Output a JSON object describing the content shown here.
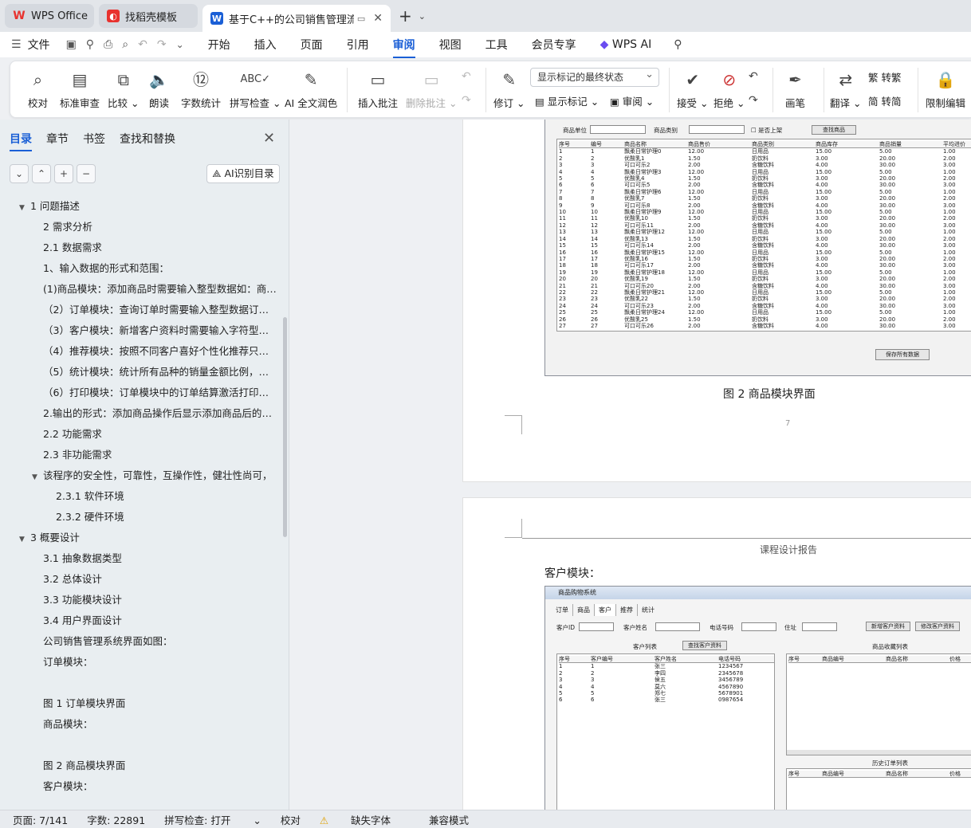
{
  "tabs": [
    {
      "label": "WPS Office",
      "icon": "wps-logo-icon",
      "color": "#e8322e"
    },
    {
      "label": "找稻壳模板",
      "icon": "docer-icon",
      "color": "#e8322e"
    },
    {
      "label": "基于C++的公司销售管理流程",
      "icon": "writer-icon",
      "color": "#1a5fd6"
    }
  ],
  "menu": {
    "file": "文件",
    "items": [
      "开始",
      "插入",
      "页面",
      "引用",
      "审阅",
      "视图",
      "工具",
      "会员专享"
    ],
    "active": "审阅",
    "wps_ai": "WPS AI"
  },
  "toolbar": {
    "proofread": "校对",
    "std_review": "标准审查",
    "compare": "比较",
    "read_aloud": "朗读",
    "word_count": "字数统计",
    "spell_check": "拼写检查",
    "ai_polish": "AI 全文润色",
    "insert_comment": "插入批注",
    "delete_comment": "删除批注",
    "revise": "修订",
    "markup_select": "显示标记的最终状态",
    "show_markup": "显示标记",
    "review": "审阅",
    "accept": "接受",
    "reject": "拒绝",
    "pen": "画笔",
    "translate": "翻译",
    "to_traditional": "转繁",
    "to_simplified": "转简",
    "restrict_edit": "限制编辑"
  },
  "sidebar": {
    "tabs": [
      "目录",
      "章节",
      "书签",
      "查找和替换"
    ],
    "active_tab": "目录",
    "ai_button": "AI识别目录",
    "toc": [
      {
        "text": "1  问题描述",
        "level": 0,
        "expand": "down"
      },
      {
        "text": "2  需求分析",
        "level": 1
      },
      {
        "text": "2.1  数据需求",
        "level": 1
      },
      {
        "text": "1、输入数据的形式和范围：",
        "level": 1
      },
      {
        "text": "(1)商品模块：添加商品时需要输入整型数据如：商品编号、商品名称等",
        "level": 1
      },
      {
        "text": "（2）订单模块：查询订单时需要输入整型数据订单编号等",
        "level": 1
      },
      {
        "text": "（3）客户模块：新增客户资料时需要输入字符型数据等",
        "level": 1
      },
      {
        "text": "（4）推荐模块：按照不同客户喜好个性化推荐只需要选择客户",
        "level": 1
      },
      {
        "text": "（5）统计模块：统计所有品种的销量金额比例，并生成图表",
        "level": 1
      },
      {
        "text": "（6）打印模块：订单模块中的订单结算激活打印功能",
        "level": 1
      },
      {
        "text": "2.输出的形式：添加商品操作后显示添加商品后的商品列表",
        "level": 1
      },
      {
        "text": "2.2  功能需求",
        "level": 1
      },
      {
        "text": "2.3  非功能需求",
        "level": 1
      },
      {
        "text": "该程序的安全性，可靠性，互操作性，健壮性尚可，",
        "level": 1,
        "expand": "down"
      },
      {
        "text": "2.3.1 软件环境",
        "level": 2
      },
      {
        "text": "2.3.2 硬件环境",
        "level": 2
      },
      {
        "text": "3  概要设计",
        "level": 0,
        "expand": "down"
      },
      {
        "text": "3.1 抽象数据类型",
        "level": 1
      },
      {
        "text": "3.2  总体设计",
        "level": 1
      },
      {
        "text": "3.3  功能模块设计",
        "level": 1
      },
      {
        "text": "3.4  用户界面设计",
        "level": 1
      },
      {
        "text": "公司销售管理系统界面如图：",
        "level": 1
      },
      {
        "text": "订单模块：",
        "level": 1
      },
      {
        "text": "",
        "level": 1
      },
      {
        "text": "图 1  订单模块界面",
        "level": 1
      },
      {
        "text": "商品模块：",
        "level": 1
      },
      {
        "text": "",
        "level": 1
      },
      {
        "text": "图 2  商品模块界面",
        "level": 1
      },
      {
        "text": "客户模块：",
        "level": 1
      }
    ]
  },
  "doc": {
    "page1": {
      "filter_labels": [
        "商品单位",
        "商品类别",
        "是否上架"
      ],
      "find_button": "查找商品",
      "save_button": "保存所有数据",
      "table_headers": [
        "序号",
        "编号",
        "商品名称",
        "商品售价",
        "商品类别",
        "商品库存",
        "商品销量",
        "平均进价"
      ],
      "rows": [
        [
          "1",
          "1",
          "飘柔日常护理0",
          "12.00",
          "日用品",
          "15.00",
          "5.00",
          "1.00"
        ],
        [
          "2",
          "2",
          "优酸乳1",
          "1.50",
          "奶饮料",
          "3.00",
          "20.00",
          "2.00"
        ],
        [
          "3",
          "3",
          "可口可乐2",
          "2.00",
          "含糖饮料",
          "4.00",
          "30.00",
          "3.00"
        ],
        [
          "4",
          "4",
          "飘柔日常护理3",
          "12.00",
          "日用品",
          "15.00",
          "5.00",
          "1.00"
        ],
        [
          "5",
          "5",
          "优酸乳4",
          "1.50",
          "奶饮料",
          "3.00",
          "20.00",
          "2.00"
        ],
        [
          "6",
          "6",
          "可口可乐5",
          "2.00",
          "含糖饮料",
          "4.00",
          "30.00",
          "3.00"
        ],
        [
          "7",
          "7",
          "飘柔日常护理6",
          "12.00",
          "日用品",
          "15.00",
          "5.00",
          "1.00"
        ],
        [
          "8",
          "8",
          "优酸乳7",
          "1.50",
          "奶饮料",
          "3.00",
          "20.00",
          "2.00"
        ],
        [
          "9",
          "9",
          "可口可乐8",
          "2.00",
          "含糖饮料",
          "4.00",
          "30.00",
          "3.00"
        ],
        [
          "10",
          "10",
          "飘柔日常护理9",
          "12.00",
          "日用品",
          "15.00",
          "5.00",
          "1.00"
        ],
        [
          "11",
          "11",
          "优酸乳10",
          "1.50",
          "奶饮料",
          "3.00",
          "20.00",
          "2.00"
        ],
        [
          "12",
          "12",
          "可口可乐11",
          "2.00",
          "含糖饮料",
          "4.00",
          "30.00",
          "3.00"
        ],
        [
          "13",
          "13",
          "飘柔日常护理12",
          "12.00",
          "日用品",
          "15.00",
          "5.00",
          "1.00"
        ],
        [
          "14",
          "14",
          "优酸乳13",
          "1.50",
          "奶饮料",
          "3.00",
          "20.00",
          "2.00"
        ],
        [
          "15",
          "15",
          "可口可乐14",
          "2.00",
          "含糖饮料",
          "4.00",
          "30.00",
          "3.00"
        ],
        [
          "16",
          "16",
          "飘柔日常护理15",
          "12.00",
          "日用品",
          "15.00",
          "5.00",
          "1.00"
        ],
        [
          "17",
          "17",
          "优酸乳16",
          "1.50",
          "奶饮料",
          "3.00",
          "20.00",
          "2.00"
        ],
        [
          "18",
          "18",
          "可口可乐17",
          "2.00",
          "含糖饮料",
          "4.00",
          "30.00",
          "3.00"
        ],
        [
          "19",
          "19",
          "飘柔日常护理18",
          "12.00",
          "日用品",
          "15.00",
          "5.00",
          "1.00"
        ],
        [
          "20",
          "20",
          "优酸乳19",
          "1.50",
          "奶饮料",
          "3.00",
          "20.00",
          "2.00"
        ],
        [
          "21",
          "21",
          "可口可乐20",
          "2.00",
          "含糖饮料",
          "4.00",
          "30.00",
          "3.00"
        ],
        [
          "22",
          "22",
          "飘柔日常护理21",
          "12.00",
          "日用品",
          "15.00",
          "5.00",
          "1.00"
        ],
        [
          "23",
          "23",
          "优酸乳22",
          "1.50",
          "奶饮料",
          "3.00",
          "20.00",
          "2.00"
        ],
        [
          "24",
          "24",
          "可口可乐23",
          "2.00",
          "含糖饮料",
          "4.00",
          "30.00",
          "3.00"
        ],
        [
          "25",
          "25",
          "飘柔日常护理24",
          "12.00",
          "日用品",
          "15.00",
          "5.00",
          "1.00"
        ],
        [
          "26",
          "26",
          "优酸乳25",
          "1.50",
          "奶饮料",
          "3.00",
          "20.00",
          "2.00"
        ],
        [
          "27",
          "27",
          "可口可乐26",
          "2.00",
          "含糖饮料",
          "4.00",
          "30.00",
          "3.00"
        ]
      ],
      "caption": "图 2  商品模块界面",
      "page_number": "7"
    },
    "page2": {
      "header": "课程设计报告",
      "section": "客户模块：",
      "window_title": "商品购物系统",
      "app_tabs": [
        "订单",
        "商品",
        "客户",
        "推荐",
        "统计"
      ],
      "field_labels": [
        "客户ID",
        "客户姓名",
        "电话号码",
        "住址"
      ],
      "buttons": [
        "新增客户资料",
        "修改客户资料"
      ],
      "customer_list_title": "客户列表",
      "find_customer": "查找客户资料",
      "fav_list_title": "商品收藏列表",
      "history_title": "历史订单列表",
      "cust_headers": [
        "序号",
        "客户编号",
        "客户姓名",
        "电话号码"
      ],
      "cust_rows": [
        [
          "1",
          "1",
          "张三",
          "1234567"
        ],
        [
          "2",
          "2",
          "李四",
          "2345678"
        ],
        [
          "3",
          "3",
          "侯五",
          "3456789"
        ],
        [
          "4",
          "4",
          "莫六",
          "4567890"
        ],
        [
          "5",
          "5",
          "郑七",
          "5678901"
        ],
        [
          "6",
          "6",
          "张三",
          "0987654"
        ]
      ],
      "fav_headers": [
        "序号",
        "商品编号",
        "商品名称",
        "价格"
      ]
    }
  },
  "status": {
    "page": "页面: 7/141",
    "words": "字数: 22891",
    "spell": "拼写检查: 打开",
    "proof": "校对",
    "missing_font": "缺失字体",
    "compat": "兼容模式"
  }
}
